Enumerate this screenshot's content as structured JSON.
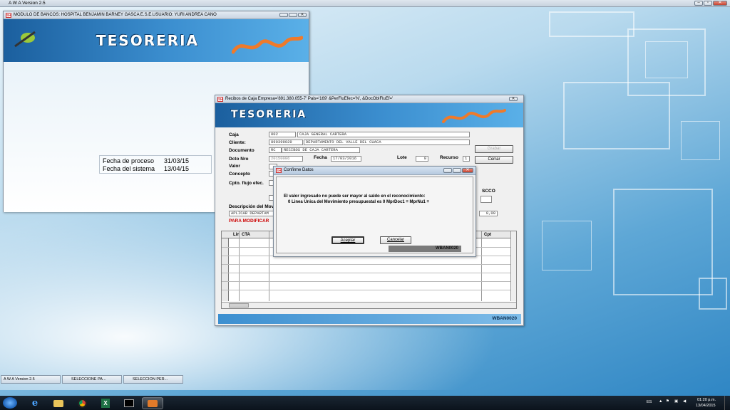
{
  "app": {
    "title": "A W A Version 2.5"
  },
  "main_window": {
    "title": "MODULO DE BANCOS: HOSPITAL BENJAMIN BARNEY GASCA E.S.E.USUARIO: YURI ANDREA CANO",
    "logo_text": "TESORERIA",
    "fecha_proceso_label": "Fecha de proceso",
    "fecha_proceso": "31/03/15",
    "fecha_sistema_label": "Fecha del sistema",
    "fecha_sistema": "13/04/15"
  },
  "recibos_window": {
    "title": "Recibos de Caja  Empresa='891.380.055-7'  Pais='169'  &PerFluEfec='N',  &DocObIFluEf='",
    "logo_text": "TESORERIA",
    "caja_label": "Caja",
    "caja_code": "002",
    "caja_name": "CAJA GENERAL CARTERA",
    "cliente_label": "Cliente:",
    "cliente_code": "890399029",
    "cliente_name": "DEPARTAMENTO DEL VALLE DEL CUACA",
    "documento_label": "Documento",
    "documento_code": "RC",
    "documento_name": "RECIBOS DE CAJA CARTERA",
    "dcto_label": "Dcto Nro",
    "dcto_value": "20150006",
    "fecha_label": "Fecha",
    "fecha_value": "17/03/2016",
    "lote_label": "Lote",
    "lote_value": "0",
    "recurso_label": "Recurso",
    "recurso_value": "1",
    "valor_label": "Valor",
    "concepto_label": "Concepto",
    "cpto_flujo_label": "Cpto. flujo efec.",
    "descripcion_label": "Descripción del Mov",
    "descripcion_value": "APLICAR DEPARTAM",
    "para_modificar": "PARA MODIFICAR",
    "scco_label": "SCCO",
    "amount_value": "0,00",
    "grabar_button": "Grabar",
    "cerrar_button": "Cerrar",
    "grid_headers": [
      "Lin",
      "CTA",
      "Cpt"
    ],
    "status_code": "WBAN0020"
  },
  "dialog": {
    "title": "Confirme Datos",
    "message_line1": "El valor ingresado no puede ser mayor al saldo en el reconocimiento:",
    "message_line2": "0 Linea Unica del Movimiento presupuestal es  0 MprDoc1 =  MprNu1 =",
    "accept_button": "Aceptar",
    "cancel_button": "Cancelar",
    "status_code": "WBAN0020"
  },
  "minimized_tasks": [
    {
      "label": "A W A Version 2.5"
    },
    {
      "label": "SELECCIONE PA..."
    },
    {
      "label": "SELECCION PER..."
    }
  ],
  "tray": {
    "lang": "ES",
    "time": "01:20 p.m.",
    "date": "13/04/2015"
  },
  "colors": {
    "accent": "#2f86c4",
    "alert": "#cc0000",
    "taskbar": "#0f1924"
  }
}
